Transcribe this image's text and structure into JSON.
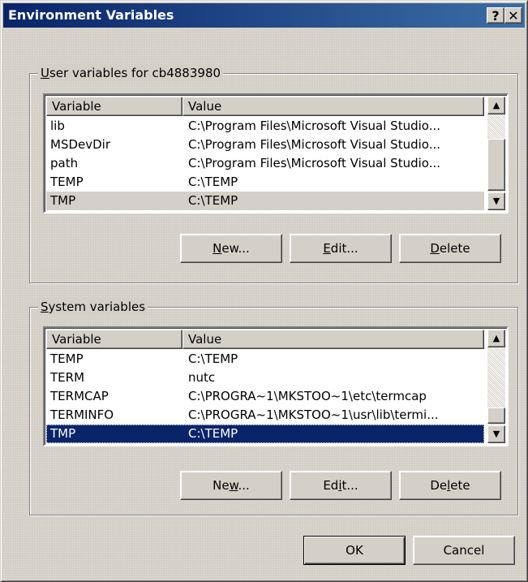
{
  "window": {
    "title": "Environment Variables",
    "help_glyph": "?",
    "close_glyph": "✕"
  },
  "user_group": {
    "label_pre": "",
    "label_ul": "U",
    "label_post": "ser variables for cb4883980",
    "columns": {
      "variable": "Variable",
      "value": "Value"
    },
    "rows": [
      {
        "variable": "lib",
        "value": "C:\\Program Files\\Microsoft Visual Studio..."
      },
      {
        "variable": "MSDevDir",
        "value": "C:\\Program Files\\Microsoft Visual Studio..."
      },
      {
        "variable": "path",
        "value": "C:\\Program Files\\Microsoft Visual Studio..."
      },
      {
        "variable": "TEMP",
        "value": "C:\\TEMP"
      },
      {
        "variable": "TMP",
        "value": "C:\\TEMP"
      }
    ],
    "buttons": {
      "new": {
        "pre": "",
        "ul": "N",
        "post": "ew..."
      },
      "edit": {
        "pre": "",
        "ul": "E",
        "post": "dit..."
      },
      "delete": {
        "pre": "",
        "ul": "D",
        "post": "elete"
      }
    }
  },
  "system_group": {
    "label_pre": "",
    "label_ul": "S",
    "label_post": "ystem variables",
    "columns": {
      "variable": "Variable",
      "value": "Value"
    },
    "rows": [
      {
        "variable": "TEMP",
        "value": "C:\\TEMP"
      },
      {
        "variable": "TERM",
        "value": "nutc"
      },
      {
        "variable": "TERMCAP",
        "value": "C:\\PROGRA~1\\MKSTOO~1\\etc\\termcap"
      },
      {
        "variable": "TERMINFO",
        "value": "C:\\PROGRA~1\\MKSTOO~1\\usr\\lib\\termi..."
      },
      {
        "variable": "TMP",
        "value": "C:\\TEMP"
      }
    ],
    "buttons": {
      "new": {
        "pre": "Ne",
        "ul": "w",
        "post": "..."
      },
      "edit": {
        "pre": "Ed",
        "ul": "i",
        "post": "t..."
      },
      "delete": {
        "pre": "De",
        "ul": "l",
        "post": "ete"
      }
    }
  },
  "footer": {
    "ok_label": "OK",
    "cancel_label": "Cancel"
  },
  "scroll": {
    "up_glyph": "▲",
    "down_glyph": "▼"
  },
  "colors": {
    "titlebar": "#0a246a",
    "face": "#d4d0c8",
    "selection": "#0a246a"
  }
}
